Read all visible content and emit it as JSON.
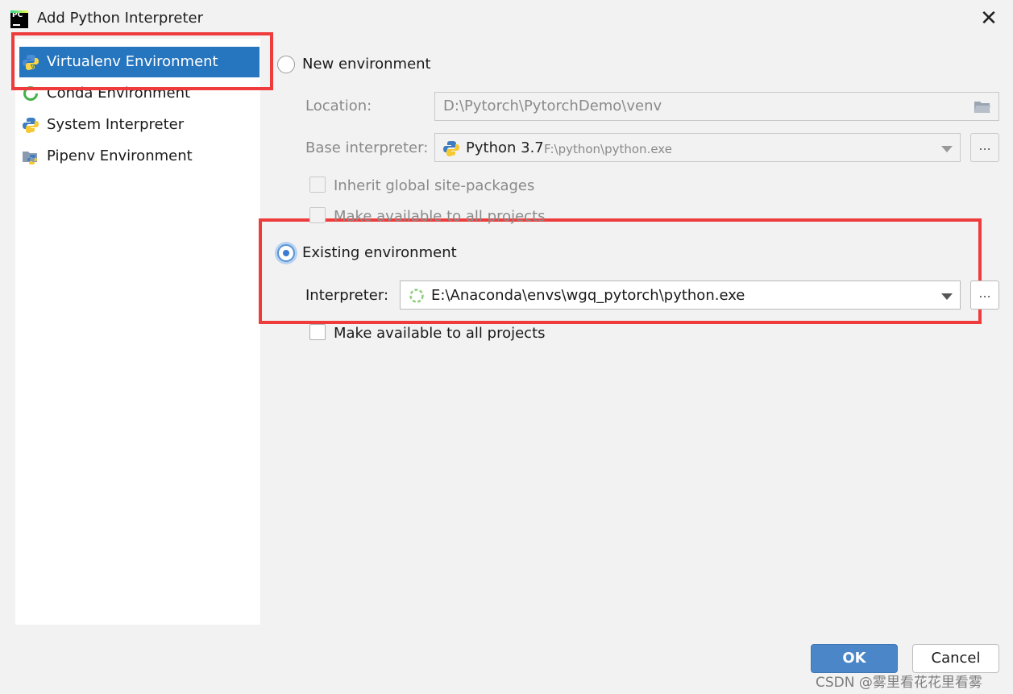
{
  "window": {
    "title": "Add Python Interpreter",
    "app_icon_text": "PC",
    "close_glyph": "✕"
  },
  "sidebar": {
    "items": [
      {
        "label": "Virtualenv Environment",
        "icon": "virtualenv-icon",
        "selected": true
      },
      {
        "label": "Conda Environment",
        "icon": "conda-icon",
        "selected": false
      },
      {
        "label": "System Interpreter",
        "icon": "python-icon",
        "selected": false
      },
      {
        "label": "Pipenv Environment",
        "icon": "pipenv-icon",
        "selected": false
      }
    ]
  },
  "new_env": {
    "radio_label": "New environment",
    "selected": false,
    "location_label": "Location:",
    "location_value": "D:\\Pytorch\\PytorchDemo\\venv",
    "base_label": "Base interpreter:",
    "base_name": "Python 3.7",
    "base_path": "F:\\python\\python.exe",
    "browse_label": "...",
    "inherit_label": "Inherit global site-packages",
    "make_available_label": "Make available to all projects"
  },
  "existing_env": {
    "radio_label": "Existing environment",
    "selected": true,
    "interpreter_label": "Interpreter:",
    "interpreter_value": "E:\\Anaconda\\envs\\wgq_pytorch\\python.exe",
    "browse_label": "...",
    "make_available_label": "Make available to all projects"
  },
  "buttons": {
    "ok": "OK",
    "cancel": "Cancel"
  },
  "watermark": "CSDN @雾里看花花里看雾",
  "colors": {
    "selection": "#2675bf",
    "annotation_red": "#ee3b3b",
    "ok_button": "#4a86c8"
  }
}
